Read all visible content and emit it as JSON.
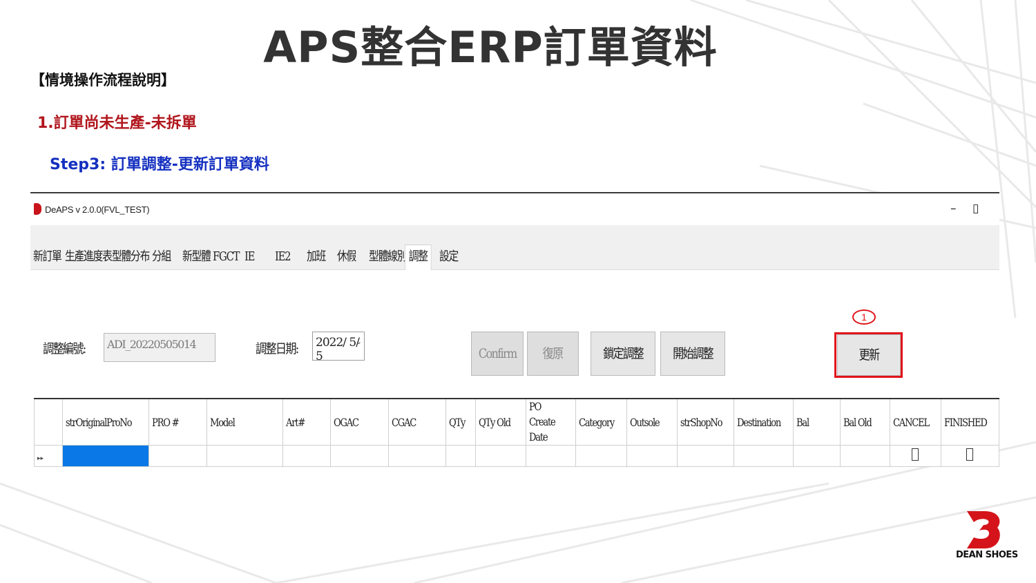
{
  "slide": {
    "title": "APS整合ERP訂單資料",
    "section_heading": "【情境操作流程說明】",
    "scenario": "1.訂單尚未生產-未拆單",
    "step": "Step3: 訂單調整-更新訂單資料"
  },
  "app": {
    "window_title": "DeAPS v 2.0.0(FVL_TEST)",
    "controls": {
      "minimize": "–",
      "maximize": "▯"
    },
    "tabs": [
      {
        "label": "新訂單"
      },
      {
        "label": "生產進度表"
      },
      {
        "label": "型體分布"
      },
      {
        "label": "分組"
      },
      {
        "label": "新型體"
      },
      {
        "label": "FGCT"
      },
      {
        "label": "IE"
      },
      {
        "label": "IE2"
      },
      {
        "label": "加班"
      },
      {
        "label": "休假"
      },
      {
        "label": "型體線別"
      },
      {
        "label": "調整"
      },
      {
        "label": "設定"
      }
    ],
    "active_tab": "調整",
    "form": {
      "adjust_no_label": "調整編號:",
      "adjust_no_value": "ADI_20220505014",
      "adjust_date_label": "調整日期:",
      "adjust_date_value": "2022/ 5/ 5"
    },
    "buttons": {
      "confirm": "Confirm",
      "restore": "復原",
      "lock_adjust": "鎖定調整",
      "start_adjust": "開始調整",
      "update": "更新"
    },
    "callout_number": "1",
    "grid": {
      "columns": [
        "",
        "strOriginalProNo",
        "PRO #",
        "Model",
        "Art#",
        "OGAC",
        "CGAC",
        "QTy",
        "QTy Old",
        "PO Create Date",
        "Category",
        "Outsole",
        "strShopNo",
        "Destination",
        "Bal",
        "Bal Old",
        "CANCEL",
        "FINISHED"
      ],
      "row_indicator": "▸▸"
    }
  },
  "brand": {
    "name": "DEAN SHOES"
  },
  "colors": {
    "accent_red": "#e0141a",
    "selection_blue": "#0a78e6",
    "scenario_red": "#b0161c",
    "step_blue": "#1530c0"
  }
}
